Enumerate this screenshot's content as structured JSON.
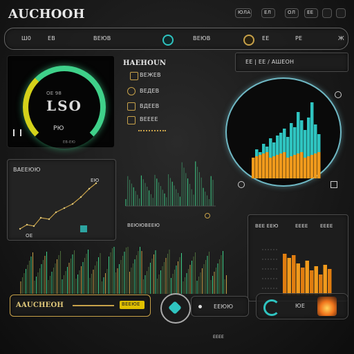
{
  "app": {
    "title": "AUCHOOH",
    "top_right_labels": [
      "ЮЛА",
      "ЕЛ",
      "ОЛ",
      "ЕЕ"
    ]
  },
  "toolbar": {
    "left_label": "Ш0",
    "label2": "ЕВ",
    "label3": "ВЕЮВ",
    "center_label": "ВЕЮВ",
    "right_label": "ЕЕ",
    "right_label2": "Ж",
    "right_label3": "РЕ"
  },
  "gauge": {
    "value_text": "LSO",
    "sub_label": "ОЕ 98",
    "bottom_label": "РЮ",
    "footer_label": "ЕВ-ЕЮ"
  },
  "legend_panel": {
    "title": "HAEHOUN",
    "items": [
      "ВЕЖЕВ",
      "ВЕДЕВ",
      "ВДЕЕВ",
      "ВЕЕЕЕ"
    ]
  },
  "radar_panel": {
    "title": "ЕЕ | ЕЕ / АШЕОН"
  },
  "trend_panel": {
    "title": "ВАЕЕЮЮ",
    "point_label": "ЕЮ",
    "start_label": "ОЕ"
  },
  "mid_chart": {
    "footer_label": "ВЕЮЮВЕЕЮ"
  },
  "right_chart": {
    "headers": [
      "ВЕЕ ЕЕЮ",
      "ЕЕЕЕ",
      "ЕЕЕЕ"
    ]
  },
  "bottom_bar": {
    "left_label": "AAUCHEOH",
    "mid_label": "ВЕЕЮЕ",
    "control_label": "ЕЕЮЮ",
    "control_sub": "ЕЕЕЕ",
    "right_label": "ЮЕ"
  },
  "colors": {
    "accent_green": "#3fd18a",
    "accent_teal": "#2fc4c0",
    "accent_orange": "#f09a1c",
    "accent_gold": "#c8a24a",
    "bg": "#161616"
  },
  "icons": [
    "gear-icon",
    "refresh-icon",
    "flame-icon",
    "chevron-icon"
  ]
}
